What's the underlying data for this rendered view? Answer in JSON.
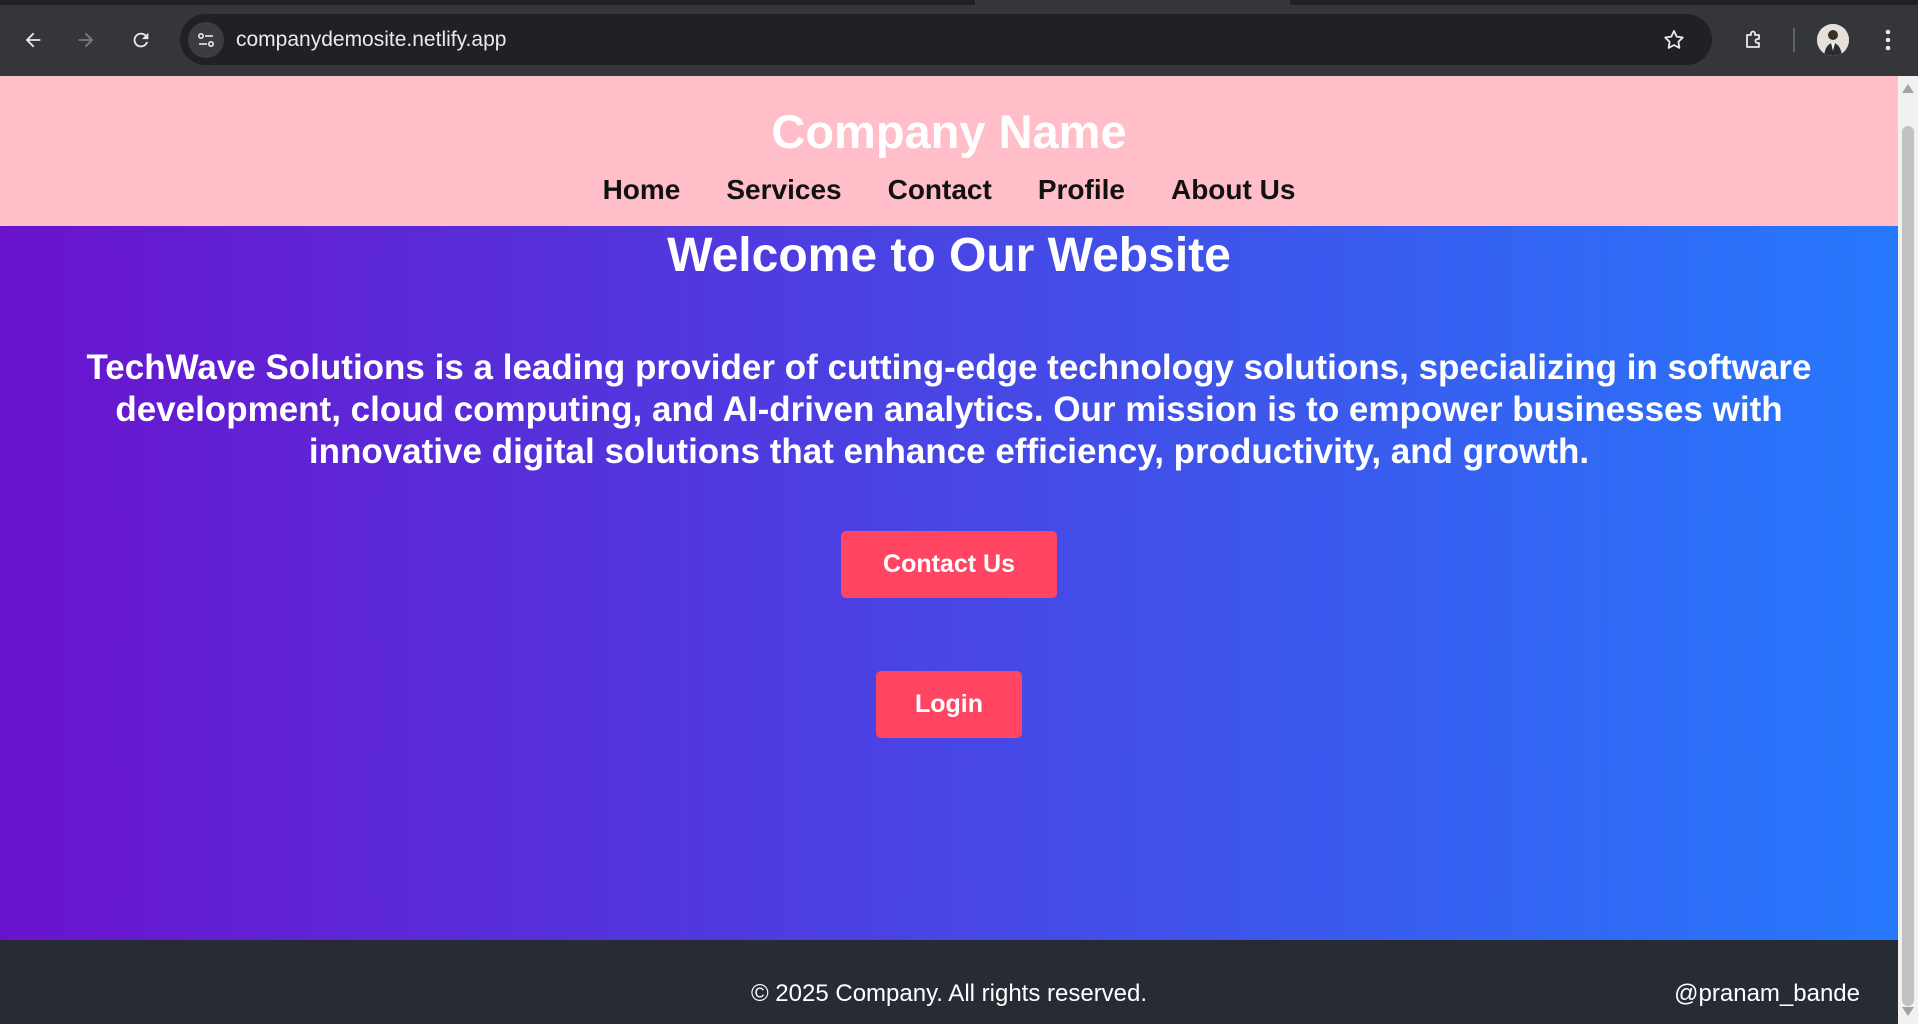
{
  "browser": {
    "url": "companydemosite.netlify.app",
    "icons": {
      "back": "back-arrow-icon",
      "forward": "forward-arrow-icon",
      "reload": "reload-icon",
      "site_info": "site-settings-icon",
      "bookmark": "star-icon",
      "extensions": "puzzle-icon",
      "profile": "avatar",
      "menu": "kebab-menu-icon"
    }
  },
  "header": {
    "title": "Company Name",
    "nav": [
      "Home",
      "Services",
      "Contact",
      "Profile",
      "About Us"
    ]
  },
  "hero": {
    "heading": "Welcome to Our Website",
    "description": "TechWave Solutions is a leading provider of cutting-edge technology solutions, specializing in software development, cloud computing, and AI-driven analytics. Our mission is to empower businesses with innovative digital solutions that enhance efficiency, productivity, and growth.",
    "contact_button": "Contact Us",
    "login_button": "Login"
  },
  "footer": {
    "copyright": "© 2025 Company. All rights reserved.",
    "handle": "@pranam_bande"
  },
  "colors": {
    "header_bg": "#ffbec8",
    "hero_gradient_start": "#6a13cd",
    "hero_gradient_end": "#2678fc",
    "button_bg": "#ff4561",
    "footer_bg": "#272b34"
  }
}
